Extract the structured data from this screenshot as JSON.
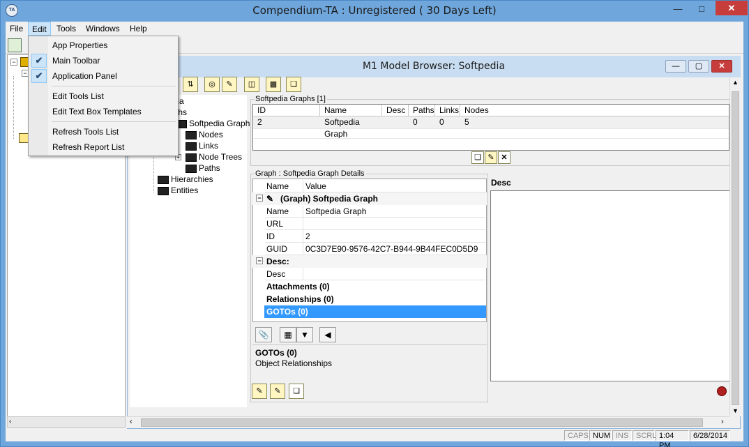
{
  "app": {
    "title": "Compendium-TA : Unregistered ( 30 Days Left)",
    "icon_text": "TA"
  },
  "menubar": [
    "File",
    "Edit",
    "Tools",
    "Windows",
    "Help"
  ],
  "edit_menu": {
    "items": [
      {
        "label": "App Properties",
        "checked": false
      },
      {
        "label": "Main Toolbar",
        "checked": true
      },
      {
        "label": "Application Panel",
        "checked": true
      },
      {
        "label": "Edit Tools List",
        "checked": false
      },
      {
        "label": "Edit Text Box Templates",
        "checked": false
      },
      {
        "label": "Refresh Tools List",
        "checked": false
      },
      {
        "label": "Refresh Report List",
        "checked": false
      }
    ]
  },
  "child_window": {
    "title": "M1 Model Browser: Softpedia"
  },
  "model_tree": {
    "items": [
      "edia",
      "raphs",
      "Softpedia Graph",
      "Nodes",
      "Links",
      "Node Trees",
      "Paths",
      "Hierarchies",
      "Entities"
    ]
  },
  "graphs_group": {
    "label": "Softpedia Graphs [1]",
    "columns": [
      "ID",
      "Name",
      "Desc",
      "Paths",
      "Links",
      "Nodes"
    ],
    "rows": [
      [
        "2",
        "Softpedia Graph",
        "",
        "0",
        "0",
        "5"
      ]
    ]
  },
  "details_group": {
    "label": "Graph : Softpedia Graph Details",
    "columns": [
      "Name",
      "Value"
    ],
    "header": "(Graph) Softpedia Graph",
    "fields": [
      {
        "name": "Name",
        "value": "Softpedia Graph"
      },
      {
        "name": "URL",
        "value": ""
      },
      {
        "name": "ID",
        "value": "2"
      },
      {
        "name": "GUID",
        "value": "0C3D7E90-9576-42C7-B944-9B44FEC0D5D9"
      }
    ],
    "desc_header": "Desc:",
    "desc_field": {
      "name": "Desc",
      "value": ""
    },
    "attachments": "Attachments (0)",
    "relationships": "Relationships (0)",
    "gotos": "GOTOs (0)",
    "info_title": "GOTOs (0)",
    "info_text": "Object Relationships"
  },
  "desc_panel": {
    "label": "Desc"
  },
  "statusbar": {
    "caps": "CAPS",
    "num": "NUM",
    "ins": "INS",
    "scrl": "SCRL",
    "time": "1:04 PM",
    "date": "6/28/2014"
  },
  "colors": {
    "title_bar": "#6fa6db",
    "child_title": "#c9ddf2",
    "selection": "#3399ff",
    "close": "#c73d3b"
  }
}
